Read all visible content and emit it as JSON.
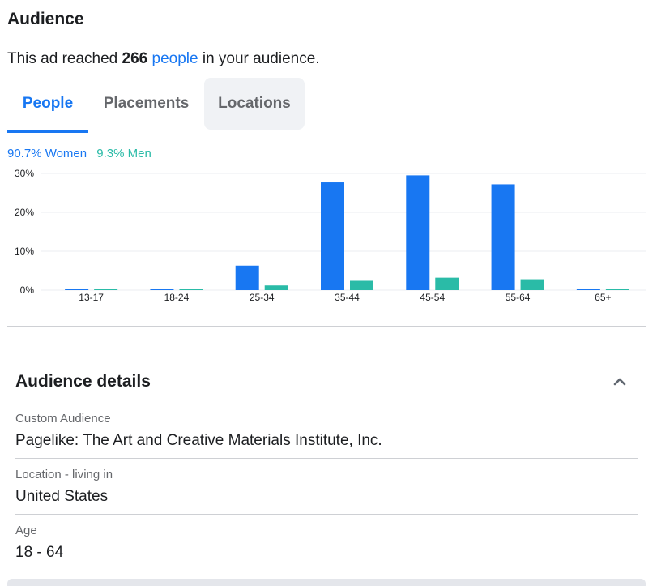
{
  "audience": {
    "title": "Audience",
    "reach_prefix": "This ad reached",
    "reach_count": "266",
    "reach_link": "people",
    "reach_suffix": "in your audience."
  },
  "tabs": [
    {
      "label": "People",
      "active": true
    },
    {
      "label": "Placements",
      "active": false
    },
    {
      "label": "Locations",
      "active": false
    }
  ],
  "gender_split": {
    "women": "90.7% Women",
    "men": "9.3% Men"
  },
  "colors": {
    "women": "#1877f2",
    "men": "#2abba7"
  },
  "chart_data": {
    "type": "bar",
    "categories": [
      "13-17",
      "18-24",
      "25-34",
      "35-44",
      "45-54",
      "55-64",
      "65+"
    ],
    "series": [
      {
        "name": "Women",
        "values": [
          0.1,
          0.1,
          6.3,
          27.7,
          29.5,
          27.2,
          0.1
        ]
      },
      {
        "name": "Men",
        "values": [
          0.1,
          0.1,
          1.2,
          2.4,
          3.2,
          2.8,
          0.1
        ]
      }
    ],
    "yticks": [
      "0%",
      "10%",
      "20%",
      "30%"
    ],
    "ylim": [
      0,
      30
    ],
    "grid": true,
    "legend": "top-left"
  },
  "details": {
    "title": "Audience details",
    "items": [
      {
        "label": "Custom Audience",
        "value": "Pagelike: The Art and Creative Materials Institute, Inc."
      },
      {
        "label": "Location - living in",
        "value": "United States"
      },
      {
        "label": "Age",
        "value": "18 - 64"
      }
    ]
  }
}
